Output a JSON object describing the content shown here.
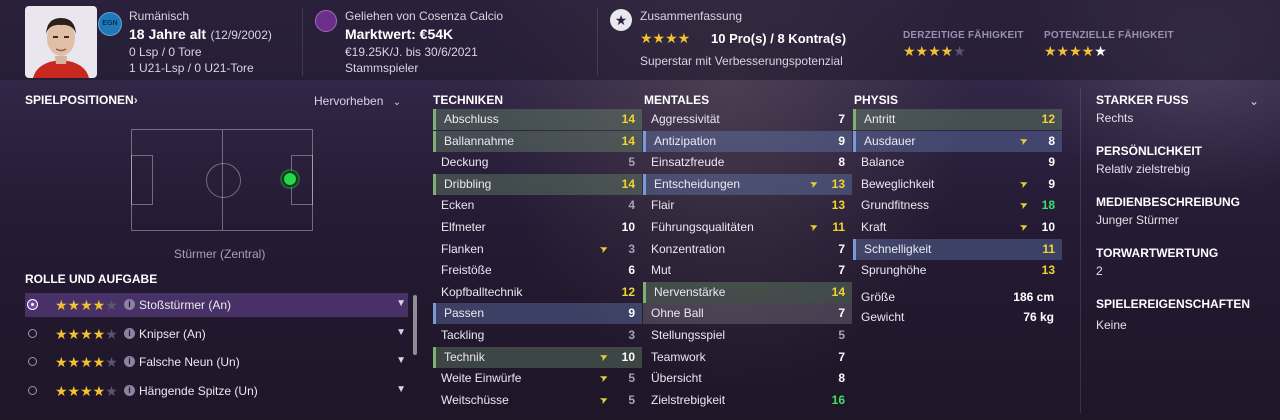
{
  "header": {
    "nationality": "Rumänisch",
    "nation_code": "EGN",
    "age": "18 Jahre alt",
    "birthdate": "(12/9/2002)",
    "caps_line": "0 Lsp / 0 Tore",
    "u21_line": "1 U21-Lsp / 0 U21-Tore",
    "loan_line": "Geliehen von Cosenza Calcio",
    "market_value": "Marktwert: €54K",
    "wage_line": "€19.25K/J. bis 30/6/2021",
    "squad_status": "Stammspieler",
    "summary_title": "Zusammenfassung",
    "summary_stars": 4,
    "summary_counts": "10 Pro(s) / 8 Kontra(s)",
    "summary_text": "Superstar mit Verbesserungspotenzial",
    "current_ability_label": "DERZEITIGE FÄHIGKEIT",
    "current_ability_stars": 4,
    "potential_ability_label": "POTENZIELLE FÄHIGKEIT",
    "potential_ability_stars": 4.5
  },
  "positions": {
    "title": "SPIELPOSITIONEN",
    "highlight_dropdown": "Hervorheben",
    "position_label": "Stürmer (Zentral)"
  },
  "roles": {
    "title": "ROLLE UND AUFGABE",
    "items": [
      {
        "label": "Stoßstürmer (An)",
        "stars": 4,
        "selected": true
      },
      {
        "label": "Knipser (An)",
        "stars": 4,
        "selected": false
      },
      {
        "label": "Falsche Neun (Un)",
        "stars": 4,
        "selected": false
      },
      {
        "label": "Hängende Spitze (Un)",
        "stars": 4,
        "selected": false
      }
    ]
  },
  "columns": {
    "technical": {
      "title": "TECHNIKEN",
      "attrs": [
        {
          "name": "Abschluss",
          "value": "14",
          "color": "yellow",
          "hl": "g",
          "arrow": false
        },
        {
          "name": "Ballannahme",
          "value": "14",
          "color": "yellow",
          "hl": "g",
          "arrow": false
        },
        {
          "name": "Deckung",
          "value": "5",
          "color": "grey",
          "hl": "",
          "arrow": false
        },
        {
          "name": "Dribbling",
          "value": "14",
          "color": "yellow",
          "hl": "g",
          "arrow": false
        },
        {
          "name": "Ecken",
          "value": "4",
          "color": "grey",
          "hl": "",
          "arrow": false
        },
        {
          "name": "Elfmeter",
          "value": "10",
          "color": "white",
          "hl": "",
          "arrow": false
        },
        {
          "name": "Flanken",
          "value": "3",
          "color": "grey",
          "hl": "",
          "arrow": true
        },
        {
          "name": "Freistöße",
          "value": "6",
          "color": "white",
          "hl": "",
          "arrow": false
        },
        {
          "name": "Kopfballtechnik",
          "value": "12",
          "color": "yellow",
          "hl": "",
          "arrow": false
        },
        {
          "name": "Passen",
          "value": "9",
          "color": "white",
          "hl": "b",
          "arrow": false
        },
        {
          "name": "Tackling",
          "value": "3",
          "color": "grey",
          "hl": "",
          "arrow": false
        },
        {
          "name": "Technik",
          "value": "10",
          "color": "white",
          "hl": "g",
          "arrow": true
        },
        {
          "name": "Weite Einwürfe",
          "value": "5",
          "color": "grey",
          "hl": "",
          "arrow": true
        },
        {
          "name": "Weitschüsse",
          "value": "5",
          "color": "grey",
          "hl": "",
          "arrow": true
        }
      ]
    },
    "mental": {
      "title": "MENTALES",
      "attrs": [
        {
          "name": "Aggressivität",
          "value": "7",
          "color": "white",
          "hl": "",
          "arrow": false
        },
        {
          "name": "Antizipation",
          "value": "9",
          "color": "white",
          "hl": "b",
          "arrow": false
        },
        {
          "name": "Einsatzfreude",
          "value": "8",
          "color": "white",
          "hl": "",
          "arrow": false
        },
        {
          "name": "Entscheidungen",
          "value": "13",
          "color": "yellow",
          "hl": "b",
          "arrow": true
        },
        {
          "name": "Flair",
          "value": "13",
          "color": "yellow",
          "hl": "",
          "arrow": false
        },
        {
          "name": "Führungsqualitäten",
          "value": "11",
          "color": "yellow",
          "hl": "",
          "arrow": true
        },
        {
          "name": "Konzentration",
          "value": "7",
          "color": "white",
          "hl": "",
          "arrow": false
        },
        {
          "name": "Mut",
          "value": "7",
          "color": "white",
          "hl": "",
          "arrow": false
        },
        {
          "name": "Nervenstärke",
          "value": "14",
          "color": "yellow",
          "hl": "g",
          "arrow": false
        },
        {
          "name": "Ohne Ball",
          "value": "7",
          "color": "white",
          "hl": "hl",
          "arrow": false
        },
        {
          "name": "Stellungsspiel",
          "value": "5",
          "color": "grey",
          "hl": "",
          "arrow": false
        },
        {
          "name": "Teamwork",
          "value": "7",
          "color": "white",
          "hl": "",
          "arrow": false
        },
        {
          "name": "Übersicht",
          "value": "8",
          "color": "white",
          "hl": "",
          "arrow": false
        },
        {
          "name": "Zielstrebigkeit",
          "value": "16",
          "color": "green",
          "hl": "",
          "arrow": false
        }
      ]
    },
    "physical": {
      "title": "PHYSIS",
      "attrs": [
        {
          "name": "Antritt",
          "value": "12",
          "color": "yellow",
          "hl": "g",
          "arrow": false
        },
        {
          "name": "Ausdauer",
          "value": "8",
          "color": "white",
          "hl": "b",
          "arrow": true
        },
        {
          "name": "Balance",
          "value": "9",
          "color": "white",
          "hl": "",
          "arrow": false
        },
        {
          "name": "Beweglichkeit",
          "value": "9",
          "color": "white",
          "hl": "",
          "arrow": true
        },
        {
          "name": "Grundfitness",
          "value": "18",
          "color": "green",
          "hl": "",
          "arrow": true
        },
        {
          "name": "Kraft",
          "value": "10",
          "color": "white",
          "hl": "",
          "arrow": true
        },
        {
          "name": "Schnelligkeit",
          "value": "11",
          "color": "yellow",
          "hl": "b",
          "arrow": false
        },
        {
          "name": "Sprunghöhe",
          "value": "13",
          "color": "yellow",
          "hl": "",
          "arrow": false
        }
      ],
      "height_label": "Größe",
      "height_value": "186 cm",
      "weight_label": "Gewicht",
      "weight_value": "76 kg"
    }
  },
  "right_panel": {
    "foot_title": "STARKER FUSS",
    "foot_value": "Rechts",
    "personality_title": "PERSÖNLICHKEIT",
    "personality_value": "Relativ zielstrebig",
    "media_title": "MEDIENBESCHREIBUNG",
    "media_value": "Junger Stürmer",
    "gk_title": "TORWARTWERTUNG",
    "gk_value": "2",
    "traits_title": "SPIELEREIGENSCHAFTEN",
    "traits_value": "Keine"
  }
}
